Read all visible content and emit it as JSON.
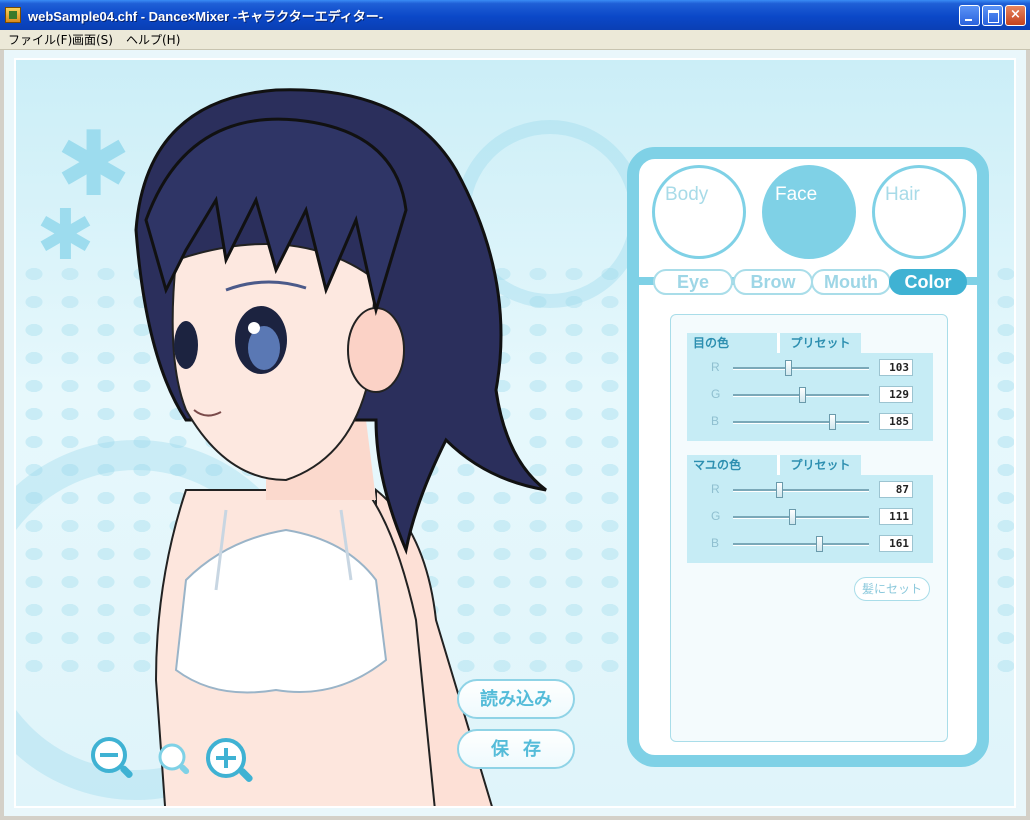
{
  "window": {
    "title": "webSample04.chf - Dance×Mixer -キャラクターエディター-",
    "icon": "app-icon",
    "minimize_icon": "minimize-icon",
    "maximize_icon": "maximize-icon",
    "close_label": "×"
  },
  "menu": {
    "items": [
      {
        "label": "ファイル(F)"
      },
      {
        "label": "画面(S)"
      },
      {
        "label": "ヘルプ(H)"
      }
    ]
  },
  "viewer": {
    "zoom_out_icon": "zoom-out-icon",
    "zoom_reset_icon": "zoom-reset-icon",
    "zoom_in_icon": "zoom-in-icon",
    "load_label": "読み込み",
    "save_label": "保存"
  },
  "editor": {
    "categories": [
      {
        "label": "Body"
      },
      {
        "label": "Face",
        "selected": true
      },
      {
        "label": "Hair"
      }
    ],
    "tabs": [
      {
        "label": "Eye"
      },
      {
        "label": "Brow"
      },
      {
        "label": "Mouth"
      },
      {
        "label": "Color",
        "selected": true
      }
    ],
    "eye_color": {
      "title": "目の色",
      "preset_label": "プリセット",
      "channels": [
        {
          "label": "R",
          "value": "103"
        },
        {
          "label": "G",
          "value": "129"
        },
        {
          "label": "B",
          "value": "185"
        }
      ]
    },
    "brow_color": {
      "title": "マユの色",
      "preset_label": "プリセット",
      "channels": [
        {
          "label": "R",
          "value": "87"
        },
        {
          "label": "G",
          "value": "111"
        },
        {
          "label": "B",
          "value": "161"
        }
      ]
    },
    "apply_to_hair_label": "髪にセット",
    "accent_color": "#7fd1e6",
    "selected_color": "#3fb2d3"
  }
}
